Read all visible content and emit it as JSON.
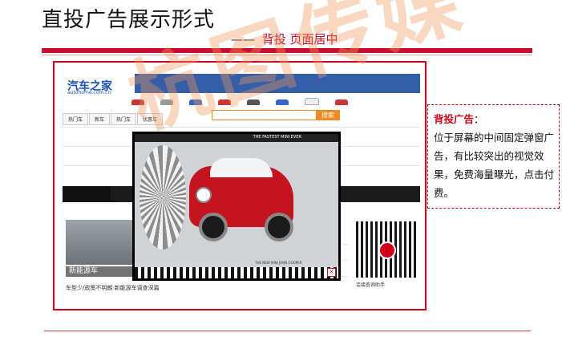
{
  "slide": {
    "title": "直投广告展示形式",
    "subtitle_dash": "——",
    "subtitle": "背投 页面居中"
  },
  "screenshot": {
    "logo_text": "汽车之家",
    "logo_sub": "autohome.com.cn",
    "search_button": "搜索",
    "tabs": [
      "热门车",
      "新车",
      "热门车",
      "优惠车"
    ],
    "left_caption": "新能源车",
    "left_caption_sub": "车型少/政策不明朗 新能源车调查深篇",
    "qr_caption": "连接查询助手"
  },
  "popup_ad": {
    "header_text": "THE FASTEST MINI EVER",
    "footer_text": "THE NEW MINI JOHN COOPER",
    "close_label": "×"
  },
  "callout": {
    "keyword": "背投广告",
    "colon": "：",
    "text": "位于屏幕的中间固定弹窗广告，有比较突出的视觉效果，免费海量曝光，点击付费。"
  },
  "watermark": "杭图传媒",
  "colors": {
    "accent_red": "#c8102e",
    "search_orange": "#f08a24",
    "nav_blue": "#355ea8"
  }
}
